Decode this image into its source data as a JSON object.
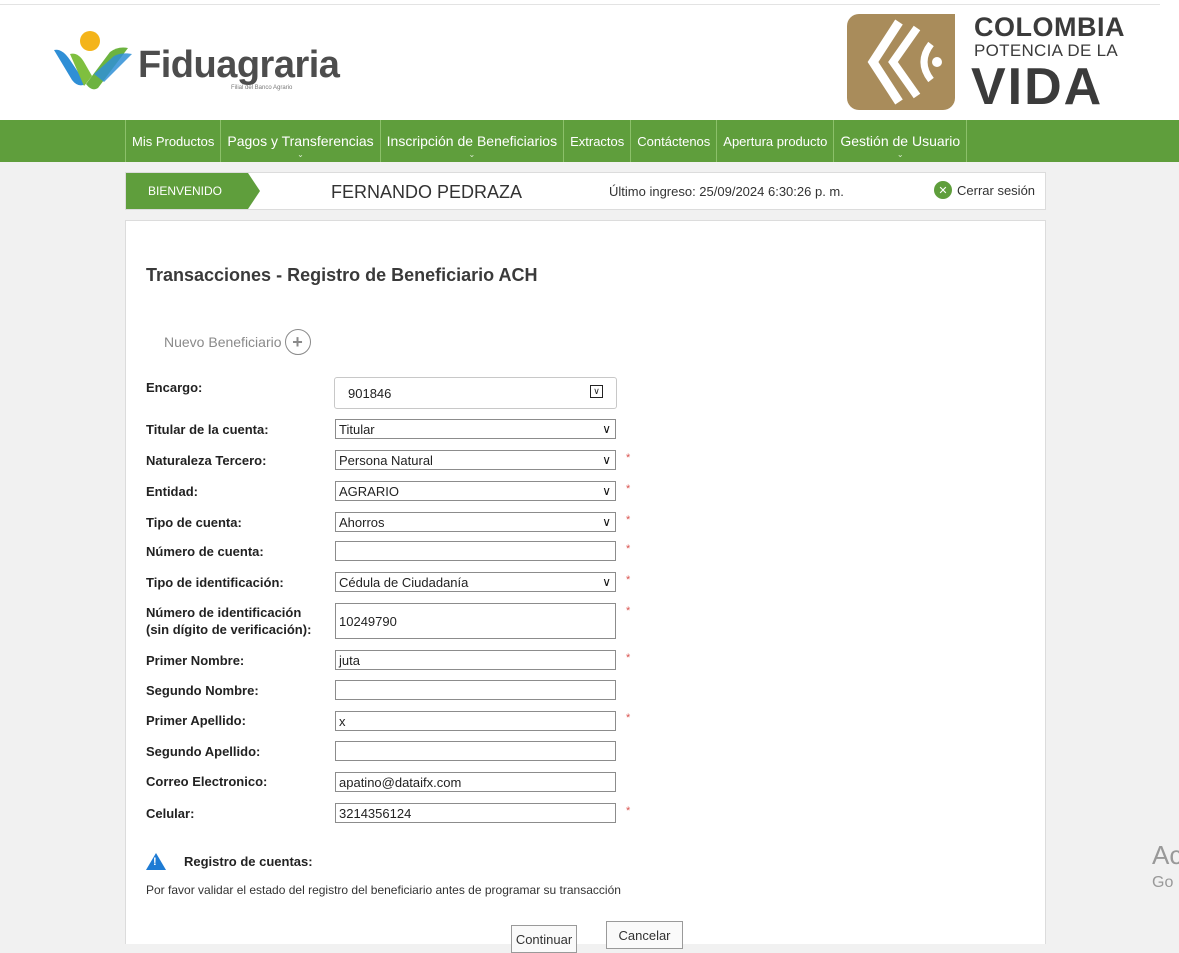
{
  "brand": {
    "logo_text": "Fiduagraria",
    "logo_subtext": "Filial del Banco Agrario",
    "gov_line1": "COLOMBIA",
    "gov_line2": "POTENCIA DE LA",
    "gov_line3": "VIDA"
  },
  "nav": {
    "items": [
      {
        "label": "Mis Productos"
      },
      {
        "label": "Pagos y Transferencias",
        "caret": "⌄"
      },
      {
        "label": "Inscripción de Beneficiarios",
        "caret": "⌄"
      },
      {
        "label": "Extractos"
      },
      {
        "label": "Contáctenos"
      },
      {
        "label": "Apertura producto"
      },
      {
        "label": "Gestión de Usuario",
        "caret": "⌄"
      }
    ]
  },
  "welcome": {
    "tag": "BIENVENIDO",
    "user_name": "FERNANDO PEDRAZA",
    "last_login": "Último ingreso: 25/09/2024 6:30:26 p. m.",
    "logout_label": "Cerrar sesión"
  },
  "page": {
    "title": "Transacciones - Registro de Beneficiario ACH",
    "new_beneficiary_label": "Nuevo Beneficiario"
  },
  "form": {
    "encargo": {
      "label": "Encargo:",
      "value": "901846"
    },
    "titular": {
      "label": "Titular de la cuenta:",
      "value": "Titular"
    },
    "naturaleza": {
      "label": "Naturaleza Tercero:",
      "value": "Persona Natural",
      "required": "*"
    },
    "entidad": {
      "label": "Entidad:",
      "value": "AGRARIO",
      "required": "*"
    },
    "tipo_cuenta": {
      "label": "Tipo de cuenta:",
      "value": "Ahorros",
      "required": "*"
    },
    "numero_cuenta": {
      "label": "Número de cuenta:",
      "value": "",
      "required": "*"
    },
    "tipo_id": {
      "label": "Tipo de identificación:",
      "value": "Cédula de Ciudadanía",
      "required": "*"
    },
    "numero_id": {
      "label_line1": "Número de identificación",
      "label_line2": "(sin dígito de verificación):",
      "value": "10249790",
      "required": "*"
    },
    "primer_nombre": {
      "label": "Primer Nombre:",
      "value": "juta",
      "required": "*"
    },
    "segundo_nombre": {
      "label": "Segundo Nombre:",
      "value": ""
    },
    "primer_apellido": {
      "label": "Primer Apellido:",
      "value": "x",
      "required": "*"
    },
    "segundo_apellido": {
      "label": "Segundo Apellido:",
      "value": ""
    },
    "correo": {
      "label": "Correo Electronico:",
      "value": "apatino@dataifx.com"
    },
    "celular": {
      "label": "Celular:",
      "value": "3214356124",
      "required": "*"
    }
  },
  "alert": {
    "title": "Registro de cuentas:",
    "message": "Por favor validar el estado del registro del beneficiario antes de programar su transacción"
  },
  "buttons": {
    "continue": "Continuar",
    "cancel": "Cancelar"
  },
  "os_overlay": {
    "line1": "Ac",
    "line2": "Go"
  },
  "colors": {
    "brand_green": "#5f9e3c",
    "gov_gold": "#a98c5b",
    "required_red": "#d9534f",
    "info_blue": "#1e7bd4"
  }
}
